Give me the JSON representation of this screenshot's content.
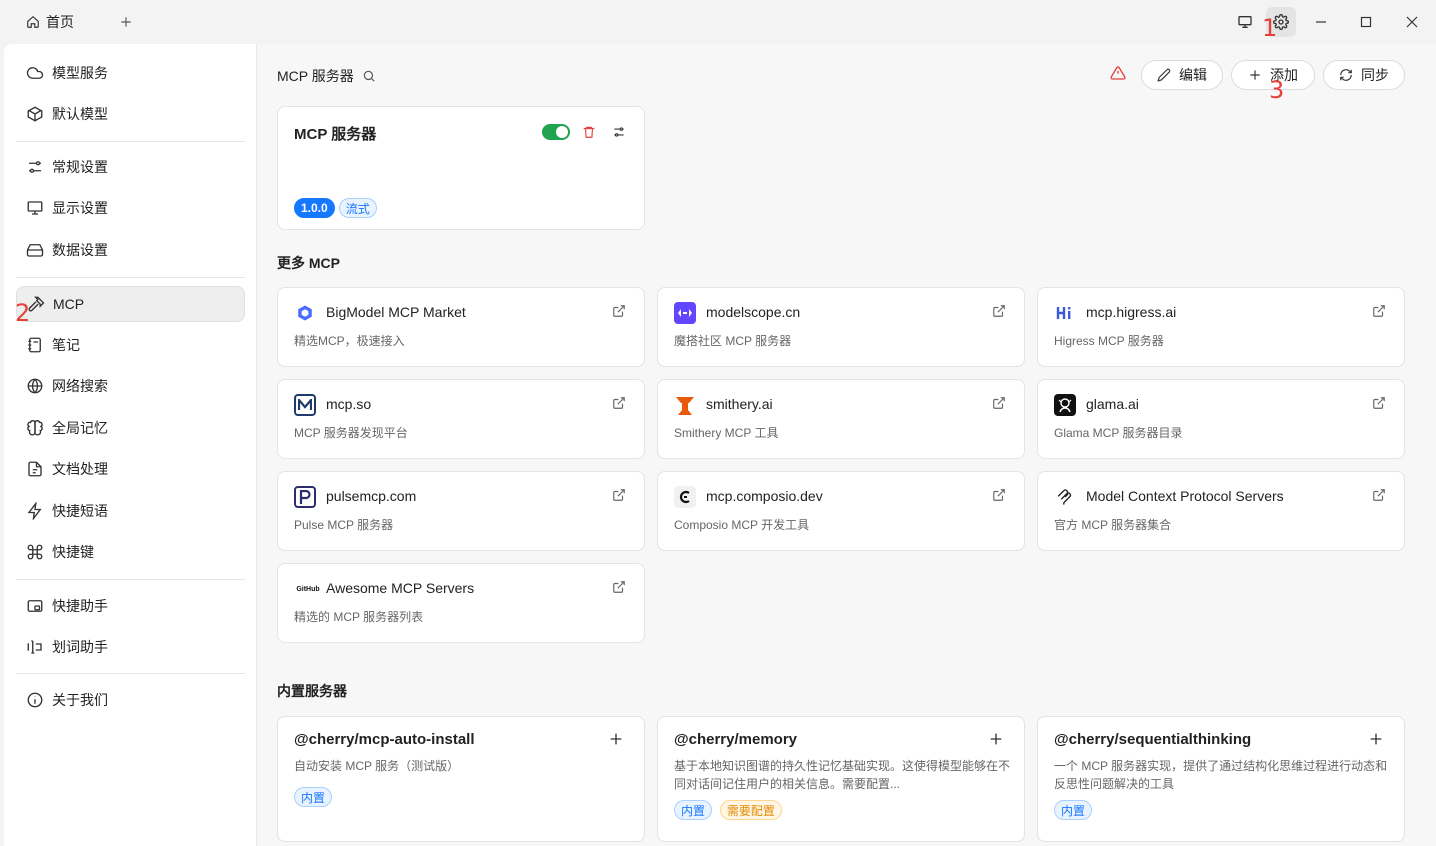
{
  "titlebar": {
    "home_tab": "首页",
    "markers": [
      "1",
      "2",
      "3"
    ]
  },
  "sidebar": {
    "items": [
      {
        "label": "模型服务",
        "icon": "cloud-icon"
      },
      {
        "label": "默认模型",
        "icon": "cube-icon"
      },
      {
        "label": "常规设置",
        "icon": "sliders-icon"
      },
      {
        "label": "显示设置",
        "icon": "monitor-icon"
      },
      {
        "label": "数据设置",
        "icon": "hard-drive-icon"
      },
      {
        "label": "MCP",
        "icon": "hammer-icon"
      },
      {
        "label": "笔记",
        "icon": "notebook-icon"
      },
      {
        "label": "网络搜索",
        "icon": "globe-icon"
      },
      {
        "label": "全局记忆",
        "icon": "brain-icon"
      },
      {
        "label": "文档处理",
        "icon": "file-icon"
      },
      {
        "label": "快捷短语",
        "icon": "zap-icon"
      },
      {
        "label": "快捷键",
        "icon": "command-icon"
      },
      {
        "label": "快捷助手",
        "icon": "app-window-icon"
      },
      {
        "label": "划词助手",
        "icon": "text-cursor-icon"
      },
      {
        "label": "关于我们",
        "icon": "info-icon"
      }
    ]
  },
  "header": {
    "title": "MCP 服务器",
    "edit_label": "编辑",
    "add_label": "添加",
    "sync_label": "同步"
  },
  "server_card": {
    "title": "MCP 服务器",
    "version": "1.0.0",
    "type_tag": "流式",
    "enabled": true
  },
  "more_mcp": {
    "title": "更多 MCP",
    "items": [
      {
        "name": "BigModel MCP Market",
        "desc": "精选MCP，极速接入"
      },
      {
        "name": "modelscope.cn",
        "desc": "魔搭社区 MCP 服务器"
      },
      {
        "name": "mcp.higress.ai",
        "desc": "Higress MCP 服务器"
      },
      {
        "name": "mcp.so",
        "desc": "MCP 服务器发现平台"
      },
      {
        "name": "smithery.ai",
        "desc": "Smithery MCP 工具"
      },
      {
        "name": "glama.ai",
        "desc": "Glama MCP 服务器目录"
      },
      {
        "name": "pulsemcp.com",
        "desc": "Pulse MCP 服务器"
      },
      {
        "name": "mcp.composio.dev",
        "desc": "Composio MCP 开发工具"
      },
      {
        "name": "Model Context Protocol Servers",
        "desc": "官方 MCP 服务器集合"
      },
      {
        "name": "Awesome MCP Servers",
        "desc": "精选的 MCP 服务器列表",
        "logo_text": "GitHub"
      }
    ]
  },
  "builtin": {
    "title": "内置服务器",
    "items": [
      {
        "name": "@cherry/mcp-auto-install",
        "desc": "自动安装 MCP 服务（测试版）",
        "tags": [
          "内置"
        ]
      },
      {
        "name": "@cherry/memory",
        "desc": "基于本地知识图谱的持久性记忆基础实现。这使得模型能够在不同对话间记住用户的相关信息。需要配置...",
        "tags": [
          "内置",
          "需要配置"
        ]
      },
      {
        "name": "@cherry/sequentialthinking",
        "desc": "一个 MCP 服务器实现，提供了通过结构化思维过程进行动态和反思性问题解决的工具",
        "tags": [
          "内置"
        ]
      }
    ]
  },
  "colors": {
    "accent": "#1677ff",
    "toggle_on": "#22a350",
    "danger": "#e5413b",
    "warning": "#e38b00"
  }
}
